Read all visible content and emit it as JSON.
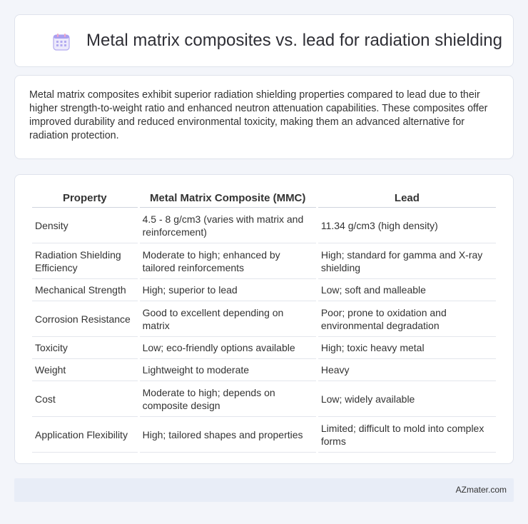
{
  "header": {
    "title": "Metal matrix composites vs. lead for radiation shielding",
    "icon": "calendar-icon"
  },
  "intro": {
    "text": "Metal matrix composites exhibit superior radiation shielding properties compared to lead due to their higher strength-to-weight ratio and enhanced neutron attenuation capabilities. These composites offer improved durability and reduced environmental toxicity, making them an advanced alternative for radiation protection."
  },
  "table": {
    "headers": [
      "Property",
      "Metal Matrix Composite (MMC)",
      "Lead"
    ],
    "rows": [
      [
        "Density",
        "4.5 - 8 g/cm3 (varies with matrix and reinforcement)",
        "11.34 g/cm3 (high density)"
      ],
      [
        "Radiation Shielding Efficiency",
        "Moderate to high; enhanced by tailored reinforcements",
        "High; standard for gamma and X-ray shielding"
      ],
      [
        "Mechanical Strength",
        "High; superior to lead",
        "Low; soft and malleable"
      ],
      [
        "Corrosion Resistance",
        "Good to excellent depending on matrix",
        "Poor; prone to oxidation and environmental degradation"
      ],
      [
        "Toxicity",
        "Low; eco-friendly options available",
        "High; toxic heavy metal"
      ],
      [
        "Weight",
        "Lightweight to moderate",
        "Heavy"
      ],
      [
        "Cost",
        "Moderate to high; depends on composite design",
        "Low; widely available"
      ],
      [
        "Application Flexibility",
        "High; tailored shapes and properties",
        "Limited; difficult to mold into complex forms"
      ]
    ]
  },
  "footer": {
    "text": "AZmater.com"
  },
  "colors": {
    "background": "#f3f5fa",
    "card": "#ffffff",
    "footer": "#e8edf7",
    "icon_accent": "#9b8fe0"
  }
}
